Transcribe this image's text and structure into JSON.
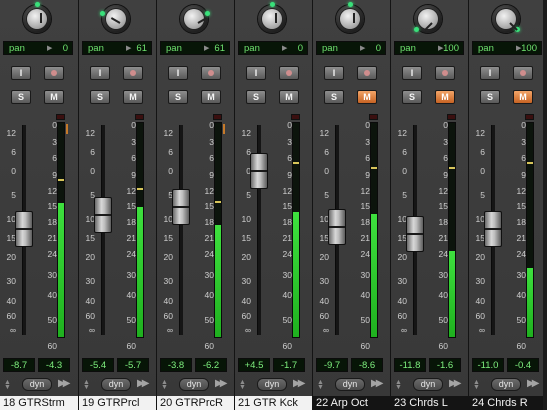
{
  "pan_label": "pan",
  "input_label": "I",
  "solo_label": "S",
  "mute_label": "M",
  "dyn_label": "dyn",
  "fader_scale": [
    "12",
    "6",
    "0",
    "5",
    "10",
    "15",
    "20",
    "30",
    "40",
    "60",
    "∞"
  ],
  "meter_scale": [
    "0",
    "3",
    "6",
    "9",
    "12",
    "15",
    "18",
    "21",
    "24",
    "30",
    "40",
    "50",
    "60"
  ],
  "channels": [
    {
      "name": "18 GTRStrm",
      "pan": "0",
      "pan_angle": 0,
      "mute_active": false,
      "volume": "-8.7",
      "peak": "-4.3",
      "fader_pos": 0.45,
      "meter_level": 0.62,
      "peak_level": 0.72,
      "name_selected": true
    },
    {
      "name": "19 GTRPrcl",
      "pan": "61",
      "pan_angle": -60,
      "mute_active": false,
      "volume": "-5.4",
      "peak": "-5.7",
      "fader_pos": 0.37,
      "meter_level": 0.6,
      "peak_level": 0.68,
      "name_selected": true
    },
    {
      "name": "20 GTRPrcR",
      "pan": "61",
      "pan_angle": 60,
      "mute_active": false,
      "volume": "-3.8",
      "peak": "-6.2",
      "fader_pos": 0.33,
      "meter_level": 0.52,
      "peak_level": 0.62,
      "name_selected": true
    },
    {
      "name": "21 GTR Kck",
      "pan": "0",
      "pan_angle": 0,
      "mute_active": false,
      "volume": "+4.5",
      "peak": "-1.7",
      "fader_pos": 0.13,
      "meter_level": 0.58,
      "peak_level": 0.8,
      "name_selected": true
    },
    {
      "name": "22  Arp Oct",
      "pan": "0",
      "pan_angle": 0,
      "mute_active": true,
      "volume": "-9.7",
      "peak": "-8.6",
      "fader_pos": 0.44,
      "meter_level": 0.57,
      "peak_level": 0.78,
      "name_selected": false
    },
    {
      "name": "23  Chrds L",
      "pan": "100",
      "pan_angle": -135,
      "mute_active": true,
      "volume": "-11.8",
      "peak": "-1.6",
      "fader_pos": 0.48,
      "meter_level": 0.4,
      "peak_level": 0.78,
      "name_selected": false
    },
    {
      "name": "24  Chrds R",
      "pan": "100",
      "pan_angle": 135,
      "mute_active": true,
      "volume": "-11.0",
      "peak": "-0.4",
      "fader_pos": 0.45,
      "meter_level": 0.32,
      "peak_level": 0.8,
      "name_selected": false
    }
  ]
}
